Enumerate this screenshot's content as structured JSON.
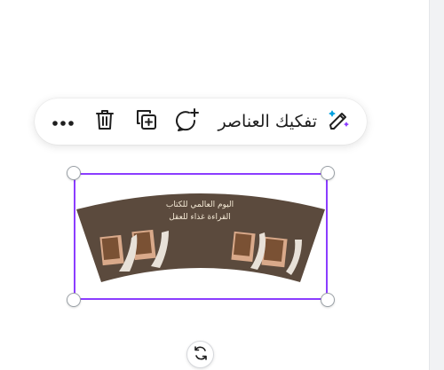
{
  "toolbar": {
    "items": [
      {
        "icon": "more-icon"
      },
      {
        "icon": "trash-icon"
      },
      {
        "icon": "duplicate-icon"
      },
      {
        "icon": "add-comment-icon"
      }
    ],
    "ungroup_label": "تفكيك العناصر",
    "magic_icon": "magic-edit-icon"
  },
  "design": {
    "line1": "اليوم العالمي للكتاب",
    "line2": "القراءة غذاء للعقل",
    "background_color": "#5b4a3d",
    "accent_color": "#d9a98a"
  },
  "selection": {
    "border_color": "#8b3dff"
  },
  "controls": {
    "rotate_icon": "rotate-icon"
  }
}
